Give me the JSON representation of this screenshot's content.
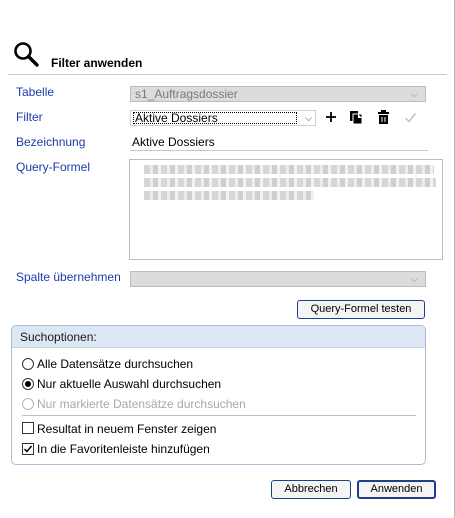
{
  "header": {
    "title": "Filter anwenden",
    "icon": "search-icon"
  },
  "form": {
    "tabelle": {
      "label": "Tabelle",
      "value": "s1_Auftragsdossier"
    },
    "filter": {
      "label": "Filter",
      "value": "Aktive Dossiers"
    },
    "bezeichnung": {
      "label": "Bezeichnung",
      "value": "Aktive Dossiers"
    },
    "query": {
      "label": "Query-Formel",
      "value": ""
    },
    "spalte": {
      "label": "Spalte übernehmen",
      "value": ""
    },
    "test_button": "Query-Formel testen"
  },
  "suchoptionen": {
    "title": "Suchoptionen:",
    "options": [
      {
        "label": "Alle Datensätze durchsuchen",
        "selected": false,
        "enabled": true
      },
      {
        "label": "Nur aktuelle Auswahl durchsuchen",
        "selected": true,
        "enabled": true
      },
      {
        "label": "Nur markierte Datensätze durchsuchen",
        "selected": false,
        "enabled": false
      }
    ],
    "checkboxes": [
      {
        "label": "Resultat in neuem Fenster zeigen",
        "checked": false
      },
      {
        "label": "In die Favoritenleiste hinzufügen",
        "checked": true
      }
    ]
  },
  "footer": {
    "cancel": "Abbrechen",
    "apply": "Anwenden"
  }
}
